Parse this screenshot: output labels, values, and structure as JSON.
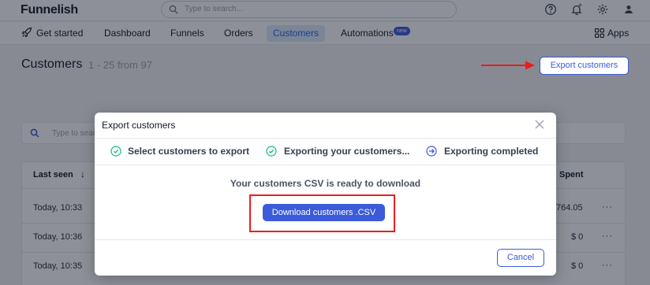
{
  "app": {
    "logo": "Funnelish",
    "search_placeholder": "Type to search..."
  },
  "nav": {
    "items": [
      {
        "label": "Get started"
      },
      {
        "label": "Dashboard"
      },
      {
        "label": "Funnels"
      },
      {
        "label": "Orders"
      },
      {
        "label": "Customers",
        "active": true
      },
      {
        "label": "Automations",
        "badge": "new"
      }
    ],
    "apps_label": "Apps"
  },
  "page": {
    "title": "Customers",
    "count_text": "1 - 25 from 97",
    "export_button": "Export customers",
    "search_placeholder": "Type to search"
  },
  "table": {
    "headers": {
      "last_seen": "Last seen",
      "spent": "Spent"
    },
    "rows": [
      {
        "last_seen": "Today, 10:33",
        "spent": "764.05"
      },
      {
        "last_seen": "Today, 10:36",
        "spent": "$ 0"
      },
      {
        "last_seen": "Today, 10:35",
        "spent": "$ 0"
      }
    ],
    "row_menu": "···"
  },
  "modal": {
    "title": "Export customers",
    "steps": [
      {
        "label": "Select customers to export",
        "icon": "check-circle-icon",
        "status": "done"
      },
      {
        "label": "Exporting your customers...",
        "icon": "check-circle-icon",
        "status": "done"
      },
      {
        "label": "Exporting completed",
        "icon": "arrow-circle-icon",
        "status": "current"
      }
    ],
    "message": "Your customers CSV is ready to download",
    "download_button": "Download customers .CSV",
    "cancel_button": "Cancel"
  },
  "colors": {
    "accent": "#3b5bdb",
    "success": "#10b981",
    "annotation_red": "#ef1c1c"
  }
}
